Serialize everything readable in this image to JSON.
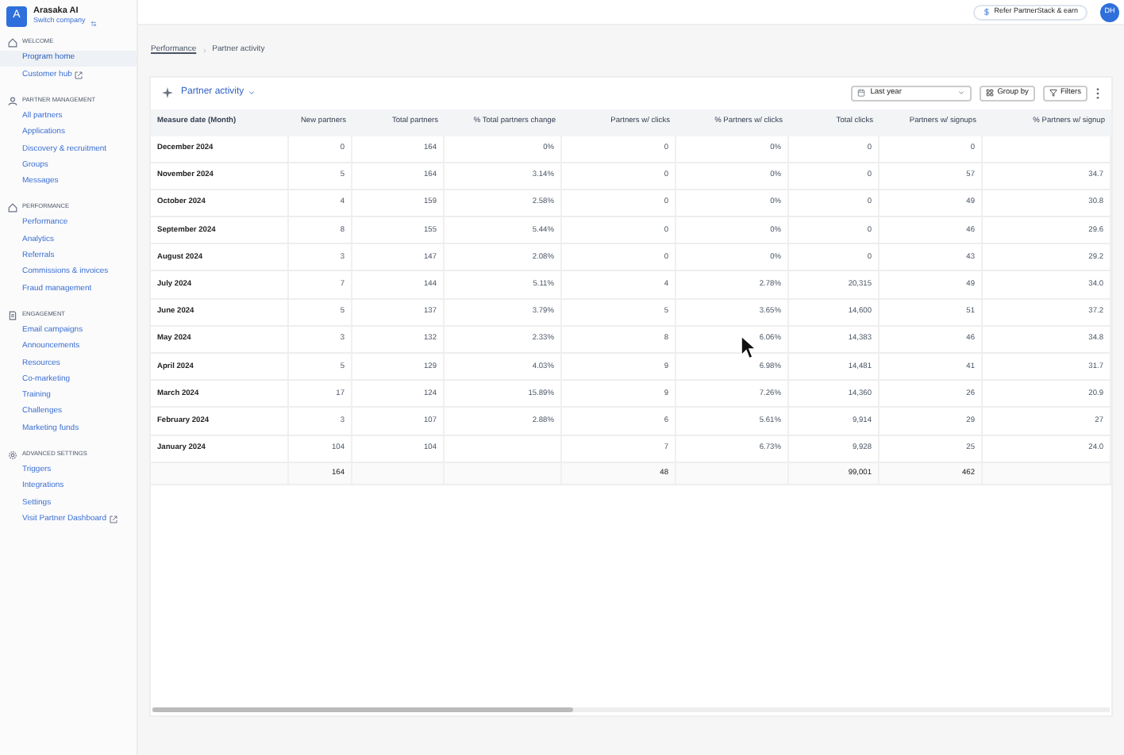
{
  "company": {
    "avatar": "A",
    "name": "Arasaka AI",
    "switch_label": "Switch company"
  },
  "sidebar": {
    "sections": [
      {
        "kind": "home",
        "title": "WELCOME",
        "items": [
          {
            "label": "Program home",
            "selected": true
          },
          {
            "label": "Customer hub",
            "external": true,
            "selected": false
          }
        ]
      },
      {
        "kind": "people",
        "title": "PARTNER MANAGEMENT",
        "items": [
          {
            "label": "All partners",
            "selected": false
          },
          {
            "label": "Applications",
            "selected": false
          },
          {
            "label": "Discovery & recruitment",
            "selected": false
          },
          {
            "label": "Groups",
            "selected": false
          },
          {
            "label": "Messages",
            "selected": false
          }
        ]
      },
      {
        "kind": "home",
        "title": "PERFORMANCE",
        "items": [
          {
            "label": "Performance",
            "selected": false
          },
          {
            "label": "Analytics",
            "selected": false
          },
          {
            "label": "Referrals",
            "selected": false
          },
          {
            "label": "Commissions & invoices",
            "selected": false
          },
          {
            "label": "Fraud management",
            "selected": false
          }
        ]
      },
      {
        "kind": "doc",
        "title": "ENGAGEMENT",
        "items": [
          {
            "label": "Email campaigns",
            "selected": false
          },
          {
            "label": "Announcements",
            "selected": false
          },
          {
            "label": "Resources",
            "selected": false
          },
          {
            "label": "Co-marketing",
            "selected": false
          },
          {
            "label": "Training",
            "selected": false
          },
          {
            "label": "Challenges",
            "selected": false
          },
          {
            "label": "Marketing funds",
            "selected": false
          }
        ]
      },
      {
        "kind": "gear",
        "title": "ADVANCED SETTINGS",
        "items": [
          {
            "label": "Triggers",
            "selected": false
          },
          {
            "label": "Integrations",
            "selected": false
          },
          {
            "label": "Settings",
            "selected": false
          },
          {
            "label": "Visit Partner Dashboard",
            "external": true,
            "selected": false
          }
        ]
      }
    ]
  },
  "topbar": {
    "refer_button": "Refer PartnerStack & earn",
    "user_avatar": "DH"
  },
  "breadcrumb": [
    "Performance",
    "Partner activity"
  ],
  "toolbar": {
    "report": "Partner activity",
    "date_range": "Last year",
    "group_by": "Group by",
    "filters": "Filters"
  },
  "table": {
    "columns": [
      "Measure date (Month)",
      "New partners",
      "Total partners",
      "% Total partners change",
      "Partners w/ clicks",
      "% Partners w/ clicks",
      "Total clicks",
      "Partners w/ signups",
      "% Partners w/ signup"
    ],
    "rows": [
      [
        "December 2024",
        "0",
        "164",
        "0%",
        "0",
        "0%",
        "0",
        "0",
        null
      ],
      [
        "November 2024",
        "5",
        "164",
        "3.14%",
        "0",
        "0%",
        "0",
        "57",
        "34.7"
      ],
      [
        "October 2024",
        "4",
        "159",
        "2.58%",
        "0",
        "0%",
        "0",
        "49",
        "30.8"
      ],
      [
        "September 2024",
        "8",
        "155",
        "5.44%",
        "0",
        "0%",
        "0",
        "46",
        "29.6"
      ],
      [
        "August 2024",
        "3",
        "147",
        "2.08%",
        "0",
        "0%",
        "0",
        "43",
        "29.2"
      ],
      [
        "July 2024",
        "7",
        "144",
        "5.11%",
        "4",
        "2.78%",
        "20,315",
        "49",
        "34.0"
      ],
      [
        "June 2024",
        "5",
        "137",
        "3.79%",
        "5",
        "3.65%",
        "14,600",
        "51",
        "37.2"
      ],
      [
        "May 2024",
        "3",
        "132",
        "2.33%",
        "8",
        "6.06%",
        "14,383",
        "46",
        "34.8"
      ],
      [
        "April 2024",
        "5",
        "129",
        "4.03%",
        "9",
        "6.98%",
        "14,481",
        "41",
        "31.7"
      ],
      [
        "March 2024",
        "17",
        "124",
        "15.89%",
        "9",
        "7.26%",
        "14,360",
        "26",
        "20.9"
      ],
      [
        "February 2024",
        "3",
        "107",
        "2.88%",
        "6",
        "5.61%",
        "9,914",
        "29",
        "27"
      ],
      [
        "January 2024",
        "104",
        "104",
        null,
        "7",
        "6.73%",
        "9,928",
        "25",
        "24.0"
      ]
    ],
    "totals": {
      "new_partners": "164",
      "partners_w_clicks": "48",
      "total_clicks": "99,001",
      "partners_w_signups": "462"
    }
  }
}
